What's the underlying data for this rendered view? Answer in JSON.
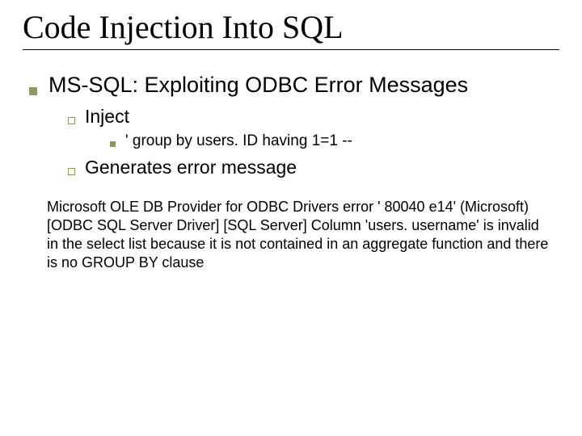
{
  "title": "Code Injection Into SQL",
  "l1": "MS-SQL: Exploiting ODBC Error Messages",
  "l2a": "Inject",
  "l3a": "' group by users. ID  having 1=1 --",
  "l2b": "Generates error message",
  "body": "Microsoft OLE DB Provider for ODBC Drivers error ' 80040 e14' (Microsoft) [ODBC SQL Server Driver] [SQL Server] Column 'users. username' is invalid in the select list because it is not contained in an aggregate function and there is no GROUP BY clause"
}
